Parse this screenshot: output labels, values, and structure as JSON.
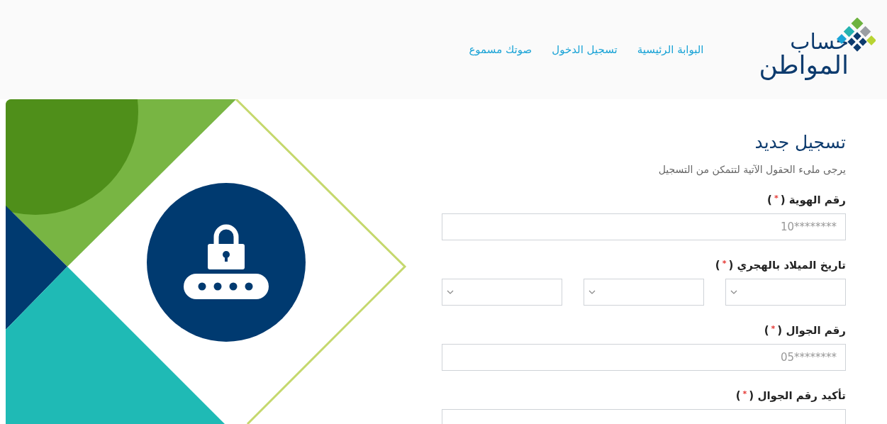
{
  "header": {
    "logo": {
      "line_1": "حساب",
      "line_2": "المواطن"
    },
    "nav": [
      {
        "label": "البوابة الرئيسية"
      },
      {
        "label": "تسجيل الدخول"
      },
      {
        "label": "صوتك مسموع"
      }
    ]
  },
  "form": {
    "title": "تسجيل جديد",
    "subtitle": "يرجى ملىء الحقول الآتية لتتمكن من التسجيل",
    "fields": [
      {
        "kind": "text",
        "label": "رقم الهوية",
        "required_mark": {
          "open": "(",
          "star": "*",
          "close": ")"
        },
        "placeholder": "10********"
      },
      {
        "kind": "date",
        "label": "تاريخ الميلاد بالهجري",
        "required_mark": {
          "open": "(",
          "star": "*",
          "close": ")"
        },
        "selects": [
          {
            "kind": "dropdown"
          },
          {
            "kind": "dropdown"
          },
          {
            "kind": "dropdown"
          }
        ]
      },
      {
        "kind": "text",
        "label": "رقم الجوال",
        "required_mark": {
          "open": "(",
          "star": "*",
          "close": ")"
        },
        "placeholder": "05********"
      },
      {
        "kind": "text",
        "label": "تأكيد رقم الجوال",
        "required_mark": {
          "open": "(",
          "star": "*",
          "close": ")"
        }
      }
    ]
  }
}
